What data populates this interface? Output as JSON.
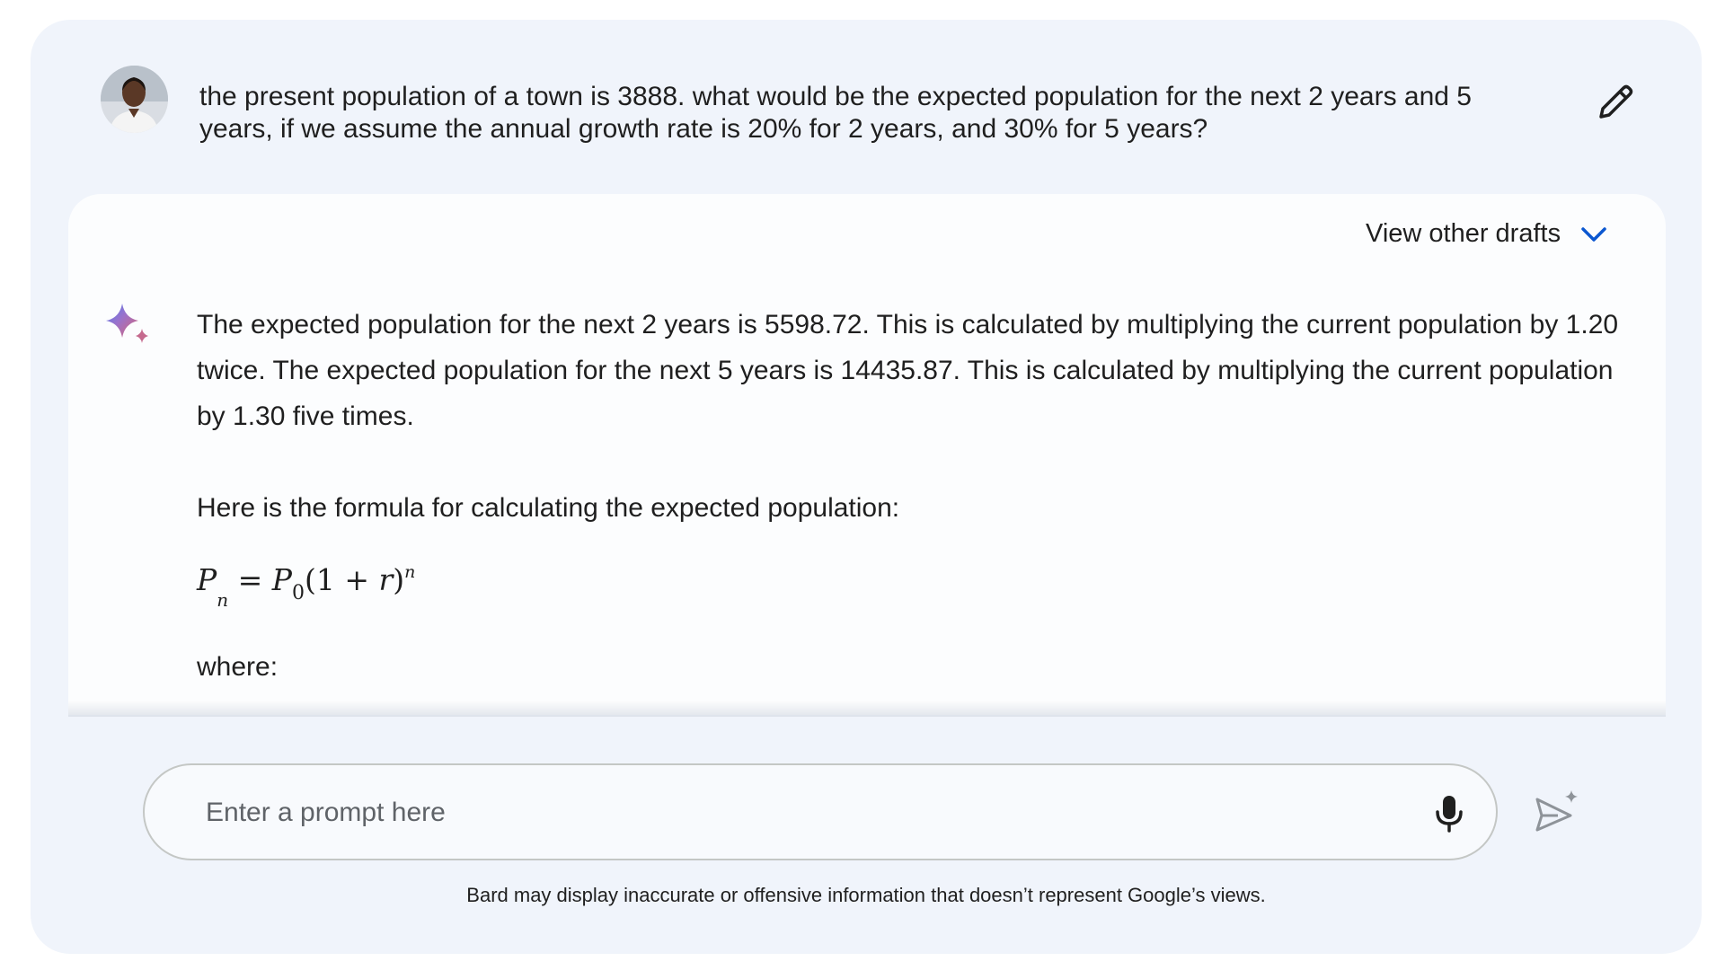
{
  "user": {
    "avatar_icon": "user-avatar-photo",
    "query": "the present population of a town is 3888. what would be the expected population for the next 2 years and 5 years, if we assume the annual growth rate is 20% for 2 years, and 30% for 5 years?",
    "edit_icon": "pencil-icon"
  },
  "response": {
    "drafts_label": "View other drafts",
    "drafts_icon": "chevron-down-icon",
    "assistant_icon": "bard-sparkle-icon",
    "paragraph_1": "The expected population for the next 2 years is 5598.72. This is calculated by multiplying the current population by 1.20 twice. The expected population for the next 5 years is 14435.87. This is calculated by multiplying the current population by 1.30 five times.",
    "paragraph_2": "Here is the formula for calculating the expected population:",
    "formula": {
      "lhs": "P",
      "lhs_sub": "n",
      "equals": "=",
      "rhs_p": "P",
      "rhs_sub": "0",
      "paren_open": "(1",
      "plus": "+",
      "r": "r",
      "paren_close": ")",
      "exponent": "n"
    },
    "where": "where:"
  },
  "input": {
    "placeholder": "Enter a prompt here",
    "value": "",
    "mic_icon": "microphone-icon",
    "send_icon": "send-icon"
  },
  "disclaimer": "Bard may display inaccurate or offensive information that doesn’t represent Google’s views.",
  "colors": {
    "background": "#f0f4fb",
    "card": "#fcfdfe",
    "accent": "#0b57d0",
    "text": "#1f1f1f"
  }
}
